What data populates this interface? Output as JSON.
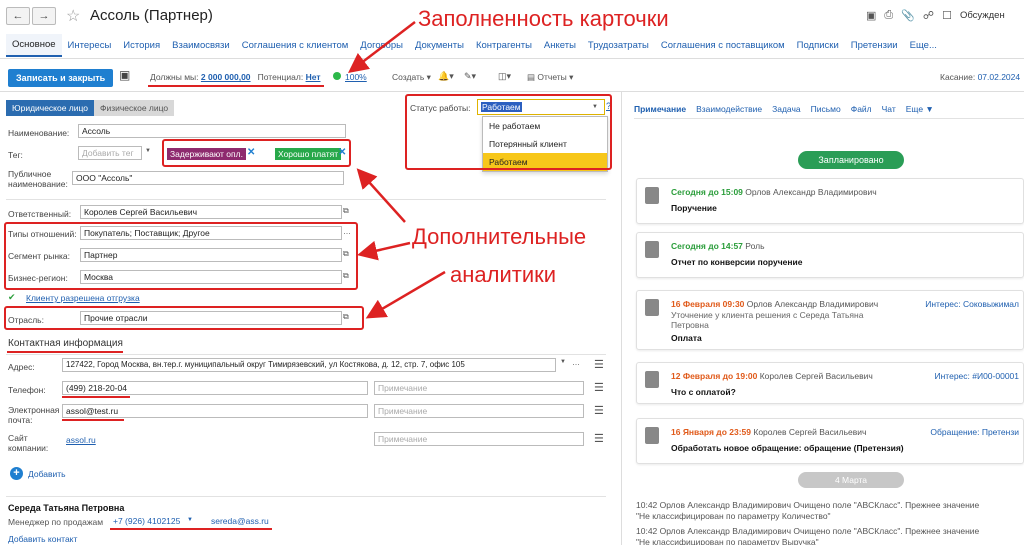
{
  "header": {
    "title": "Ассоль (Партнер)",
    "discuss": "Обсужден"
  },
  "annotations": {
    "fill": "Заполненность карточки",
    "extra1": "Дополнительные",
    "extra2": "аналитики"
  },
  "tabs": [
    "Основное",
    "Интересы",
    "История",
    "Взаимосвязи",
    "Соглашения с клиентом",
    "Договоры",
    "Документы",
    "Контрагенты",
    "Анкеты",
    "Трудозатраты",
    "Соглашения с поставщиком",
    "Подписки",
    "Претензии",
    "Еще..."
  ],
  "toolbar": {
    "save_close": "Записать и закрыть",
    "owe_label": "Должны мы:",
    "owe_value": "2 000 000,00",
    "potential_label": "Потенциал:",
    "potential_value": "Нет",
    "percent": "100%",
    "create": "Создать",
    "reports": "Отчеты",
    "touch_label": "Касание:",
    "touch_value": "07.02.2024"
  },
  "form": {
    "toggle": [
      "Юридическое лицо",
      "Физическое лицо"
    ],
    "name_label": "Наименование:",
    "name_value": "Ассоль",
    "tag_label": "Тег:",
    "tag_placeholder": "Добавить тег",
    "tags": [
      {
        "label": "Задерживают опл.",
        "color": "#8e2a6e"
      },
      {
        "label": "Хорошо платят",
        "color": "#27a84a"
      }
    ],
    "public_label": "Публичное наименование:",
    "public_value": "ООО \"Ассоль\"",
    "resp_label": "Ответственный:",
    "resp_value": "Королев Сергей Васильевич",
    "rel_label": "Типы отношений:",
    "rel_value": "Покупатель; Поставщик; Другое",
    "seg_label": "Сегмент рынка:",
    "seg_value": "Партнер",
    "region_label": "Бизнес-регион:",
    "region_value": "Москва",
    "allowed": "Клиенту разрешена отгрузка",
    "industry_label": "Отрасль:",
    "industry_value": "Прочие отрасли",
    "contacts_title": "Контактная информация",
    "addr_label": "Адрес:",
    "addr_value": "127422, Город Москва, вн.тер.г. муниципальный округ Тимирязевский, ул Костякова, д. 12, стр. 7, офис 105",
    "phone_label": "Телефон:",
    "phone_value": "(499) 218-20-04",
    "email_label": "Электронная почта:",
    "email_value": "assol@test.ru",
    "site_label": "Сайт компании:",
    "site_value": "assol.ru",
    "note_placeholder": "Примечание",
    "add": "Добавить",
    "person_name": "Середа Татьяна Петровна",
    "person_role": "Менеджер по продажам",
    "person_phone": "+7 (926) 4102125",
    "person_email": "sereda@ass.ru",
    "add_contact": "Добавить контакт"
  },
  "status": {
    "label": "Статус работы:",
    "value": "Работаем",
    "options": [
      "Не работаем",
      "Потерянный клиент",
      "Работаем"
    ]
  },
  "right": {
    "tabs": [
      "Примечание",
      "Взаимодействие",
      "Задача",
      "Письмо",
      "Файл",
      "Чат",
      "Еще ▼"
    ],
    "planned": "Запланировано",
    "date_pill": "4 Марта",
    "cards": [
      {
        "when": "Сегодня до 15:09",
        "who": "Орлов Александр Владимирович",
        "extra": "",
        "sub": "",
        "title": "Поручение",
        "tone": "green"
      },
      {
        "when": "Сегодня до 14:57",
        "who": "Роль",
        "extra": "",
        "sub": "",
        "title": "Отчет по конверсии поручение",
        "tone": "green"
      },
      {
        "when": "16 Февраля 09:30",
        "who": "Орлов Александр Владимирович",
        "extra": "Интерес: Соковыжимал",
        "sub": "Уточнение у клиента решения с Середа Татьяна Петровна",
        "title": "Оплата",
        "tone": "orange"
      },
      {
        "when": "12 Февраля до 19:00",
        "who": "Королев Сергей Васильевич",
        "extra": "Интерес: #И00-00001",
        "sub": "",
        "title": "Что с оплатой?",
        "tone": "orange"
      },
      {
        "when": "16 Января до 23:59",
        "who": "Королев Сергей Васильевич",
        "extra": "Обращение: Претензи",
        "sub": "",
        "title": "Обработать новое обращение: обращение (Претензия)",
        "tone": "orange"
      }
    ],
    "log1a": "10:42 Орлов Александр Владимирович Очищено поле \"ABCКласс\". Прежнее значение",
    "log1b": "\"Не классифицирован по параметру Количество\"",
    "log2a": "10:42 Орлов Александр Владимирович Очищено поле \"ABCКласс\". Прежнее значение",
    "log2b": "\"Не классифицирован по параметру Выручка\""
  }
}
